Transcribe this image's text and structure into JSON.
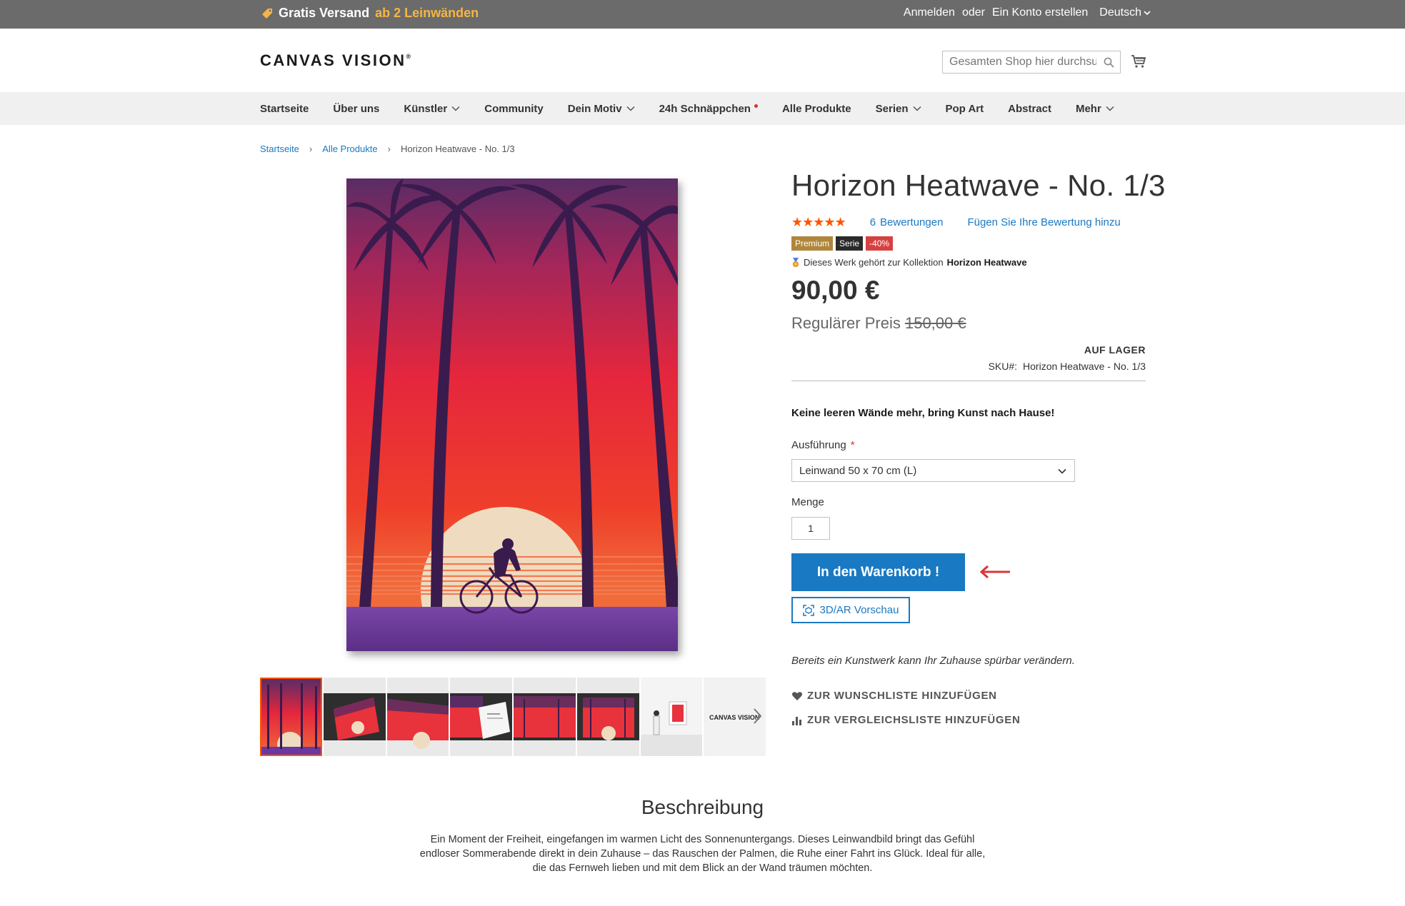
{
  "topbar": {
    "promo_prefix": "Gratis Versand",
    "promo_accent": "ab 2 Leinwänden",
    "login": "Anmelden",
    "or": "oder",
    "register": "Ein Konto erstellen",
    "language": "Deutsch"
  },
  "header": {
    "logo": "CANVAS VISION",
    "logo_mark": "®",
    "search_placeholder": "Gesamten Shop hier durchsuchen..."
  },
  "nav": {
    "items": [
      {
        "label": "Startseite"
      },
      {
        "label": "Über uns"
      },
      {
        "label": "Künstler"
      },
      {
        "label": "Community"
      },
      {
        "label": "Dein Motiv"
      },
      {
        "label": "24h Schnäppchen"
      },
      {
        "label": "Alle Produkte"
      },
      {
        "label": "Serien"
      },
      {
        "label": "Pop Art"
      },
      {
        "label": "Abstract"
      },
      {
        "label": "Mehr"
      }
    ]
  },
  "breadcrumb": {
    "home": "Startseite",
    "category": "Alle Produkte",
    "current": "Horizon Heatwave - No. 1/3"
  },
  "product": {
    "title": "Horizon Heatwave - No. 1/3",
    "stars": "★★★★★",
    "rating_fraction": 1.0,
    "review_count": "6",
    "review_label": "Bewertungen",
    "add_review": "Fügen Sie Ihre Bewertung hinzu",
    "badges": {
      "premium": "Premium",
      "serie": "Serie",
      "sale": "-40%"
    },
    "collection_text": "Dieses Werk gehört zur Kollektion",
    "collection_name": "Horizon Heatwave",
    "price": "90,00 €",
    "regular_label": "Regulärer Preis",
    "regular_price": "150,00 €",
    "stock": "AUF LAGER",
    "sku_label": "SKU#:",
    "sku_value": "Horizon Heatwave - No. 1/3",
    "slogan": "Keine leeren Wände mehr, bring Kunst nach Hause!",
    "option_label": "Ausführung",
    "option_required": "*",
    "option_value": "Leinwand 50 x 70 cm (L)",
    "qty_label": "Menge",
    "qty_value": "1",
    "add_to_cart": "In den Warenkorb !",
    "ar_preview": "3D/AR Vorschau",
    "note": "Bereits ein Kunstwerk kann Ihr Zuhause spürbar verändern.",
    "wishlist": "ZUR WUNSCHLISTE HINZUFÜGEN",
    "compare": "ZUR VERGLEICHSLISTE HINZUFÜGEN"
  },
  "thumbnails": {
    "logo_text": "CANVAS VISION"
  },
  "description": {
    "title": "Beschreibung",
    "text": "Ein Moment der Freiheit, eingefangen im warmen Licht des Sonnenuntergangs. Dieses Leinwandbild bringt das Gefühl endloser Sommerabende direkt in dein Zuhause – das Rauschen der Palmen, die Ruhe einer Fahrt ins Glück. Ideal für alle, die das Fernweh lieben und mit dem Blick an der Wand träumen möchten."
  },
  "colors": {
    "accent_blue": "#1979c3",
    "topbar_bg": "#6b6b6b",
    "promo_accent": "#f5b544",
    "star_orange": "#ff5501",
    "sale_red": "#d84040"
  }
}
